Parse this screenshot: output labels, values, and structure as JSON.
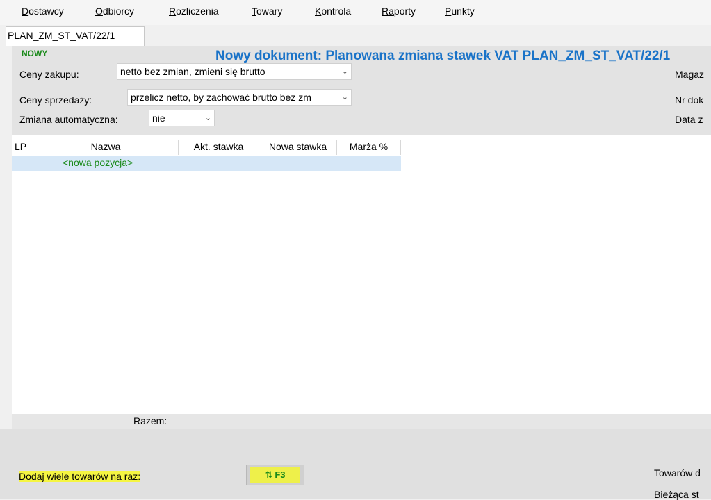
{
  "menu": {
    "items": [
      {
        "acc": "D",
        "rest": "ostawcy"
      },
      {
        "acc": "O",
        "rest": "dbiorcy"
      },
      {
        "acc": "R",
        "rest": "ozliczenia"
      },
      {
        "acc": "T",
        "rest": "owary"
      },
      {
        "acc": "K",
        "rest": "ontrola"
      },
      {
        "acc": "Ra",
        "rest": "porty"
      },
      {
        "acc": "P",
        "rest": "unkty"
      }
    ],
    "items_display": [
      "Dostawcy",
      "Odbiorcy",
      "Rozliczenia",
      "Towary",
      "Kontrola",
      "Raporty",
      "Punkty"
    ]
  },
  "tab": {
    "label": "PLAN_ZM_ST_VAT/22/1"
  },
  "header": {
    "status": "NOWY",
    "title": "Nowy dokument: Planowana zmiana stawek VAT PLAN_ZM_ST_VAT/22/1",
    "purchase_label": "Ceny zakupu:",
    "purchase_value": "netto bez zmian, zmieni się brutto",
    "sale_label": "Ceny sprzedaży:",
    "sale_value": "przelicz netto, by zachować brutto bez zm",
    "auto_label": "Zmiana automatyczna:",
    "auto_value": "nie",
    "right_labels": [
      "Magaz",
      "Nr dok",
      "Data z"
    ]
  },
  "grid": {
    "columns": [
      "LP",
      "Nazwa",
      "Akt. stawka",
      "Nowa stawka",
      "Marża %"
    ],
    "new_row": "<nowa pozycja>"
  },
  "summary": {
    "label": "Razem:"
  },
  "footer": {
    "add_many_label": "Dodaj wiele towarów na raz:",
    "f3_label": "F3",
    "right_labels": [
      "Towarów d",
      "Bieżąca st"
    ]
  },
  "colors": {
    "title": "#1a73c8",
    "status": "#1a8a1a",
    "new_row_bg": "#d6e7f7",
    "highlight": "#f5f542"
  }
}
